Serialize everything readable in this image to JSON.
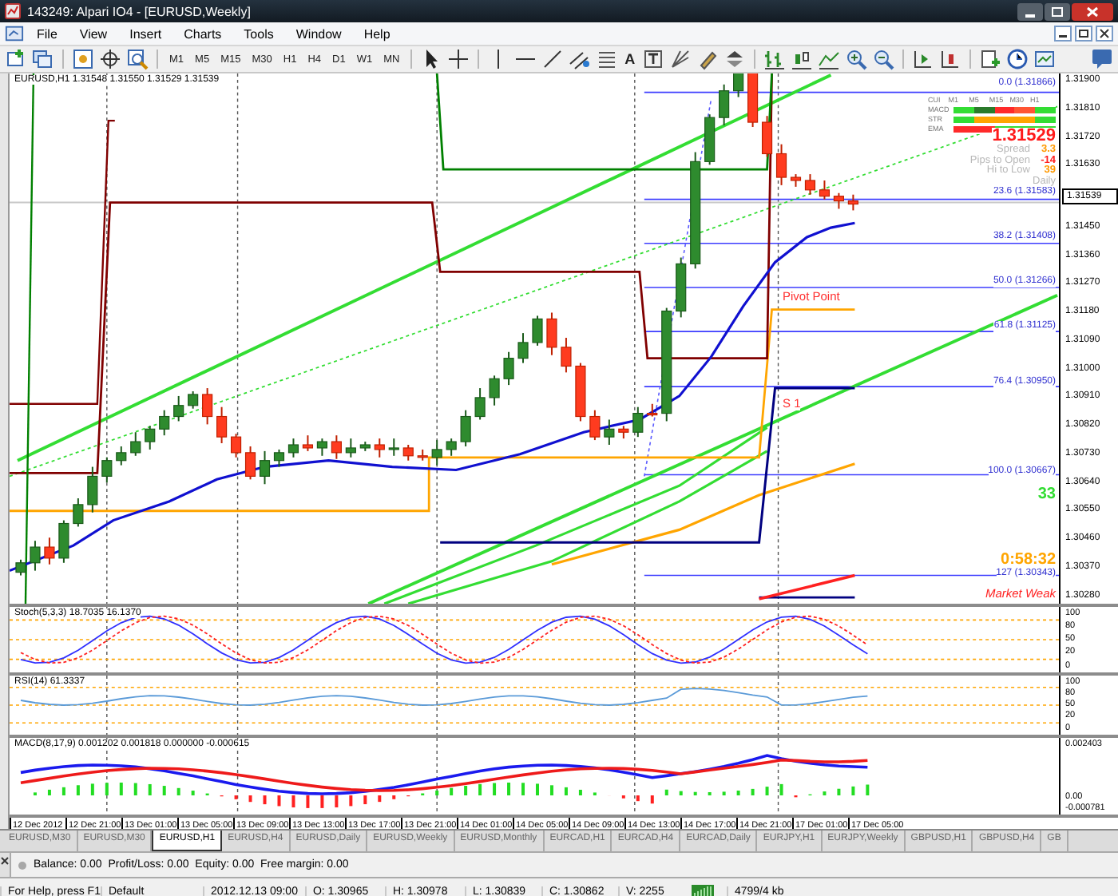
{
  "window": {
    "title": "143249: Alpari IO4 - [EURUSD,Weekly]"
  },
  "menu": [
    "File",
    "View",
    "Insert",
    "Charts",
    "Tools",
    "Window",
    "Help"
  ],
  "toolbar": {
    "timeframes": [
      "M1",
      "M5",
      "M15",
      "M30",
      "H1",
      "H4",
      "D1",
      "W1",
      "MN"
    ],
    "text_tool": "A"
  },
  "chart": {
    "header": "EURUSD,H1  1.31548 1.31550 1.31529 1.31539",
    "price_axis": [
      {
        "kind": "tick",
        "label": "1.31900"
      },
      {
        "kind": "tick",
        "label": "1.31810"
      },
      {
        "kind": "tick",
        "label": "1.31720"
      },
      {
        "kind": "tick",
        "label": "1.31630"
      },
      {
        "kind": "current",
        "label": "1.31539"
      },
      {
        "kind": "tick",
        "label": "1.31450"
      },
      {
        "kind": "tick",
        "label": "1.31360"
      },
      {
        "kind": "tick",
        "label": "1.31270"
      },
      {
        "kind": "tick",
        "label": "1.31180"
      },
      {
        "kind": "tick",
        "label": "1.31090"
      },
      {
        "kind": "tick",
        "label": "1.31000"
      },
      {
        "kind": "tick",
        "label": "1.30910"
      },
      {
        "kind": "tick",
        "label": "1.30820"
      },
      {
        "kind": "tick",
        "label": "1.30730"
      },
      {
        "kind": "tick",
        "label": "1.30640"
      },
      {
        "kind": "tick",
        "label": "1.30550"
      },
      {
        "kind": "tick",
        "label": "1.30460"
      },
      {
        "kind": "tick",
        "label": "1.30370"
      },
      {
        "kind": "tick",
        "label": "1.30280"
      }
    ],
    "fib_levels": [
      "0.0 (1.31866)",
      "23.6 (1.31583)",
      "38.2 (1.31408)",
      "50.0 (1.31266)",
      "61.8 (1.31125)",
      "76.4 (1.30950)",
      "100.0 (1.30667)",
      "127 (1.30343)"
    ],
    "pivot_labels": [
      "Pivot Point",
      "S 1"
    ],
    "dashboard": {
      "columns": [
        "CUI",
        "M1",
        "M5",
        "M15",
        "M30",
        "H1"
      ],
      "rows": [
        {
          "label": "MACD",
          "cells": [
            {
              "color": "#33dd33"
            },
            {
              "color": "#2a7a2a"
            },
            {
              "color": "#ff2a2a"
            },
            {
              "color": "#ff5533"
            },
            {
              "color": "#33dd33"
            }
          ]
        },
        {
          "label": "STR",
          "cells": [
            {
              "color": "#33dd33"
            },
            {
              "color": "#ffa500"
            },
            {
              "color": "#ffa500"
            },
            {
              "color": "#ffa500"
            },
            {
              "color": "#33dd33"
            }
          ]
        },
        {
          "label": "EMA",
          "cells": [
            {
              "color": "#ff2a2a"
            },
            {
              "color": "#ff2a2a"
            },
            {
              "color": "#33dd33"
            },
            {
              "color": "#33dd33"
            },
            {
              "color": "#33dd33"
            }
          ]
        }
      ]
    },
    "price": "1.31529",
    "stats": [
      {
        "label": "Spread",
        "value": "3.3",
        "color": "#ff9900"
      },
      {
        "label": "Pips to Open",
        "value": "-14",
        "color": "#ff2020"
      },
      {
        "label": "Hi to Low",
        "value": "39",
        "color": "#ff9900"
      },
      {
        "label": "Daily"
      }
    ],
    "counter": "33",
    "timer": "0:58:32",
    "signal": "Market Weak"
  },
  "indicators": [
    {
      "kind": "stoch",
      "header": "Stoch(5,3,3) 18.7035 16.1370",
      "axis": [
        "100",
        "80",
        "50",
        "20",
        "0"
      ]
    },
    {
      "kind": "rsi",
      "header": "RSI(14) 61.3337",
      "axis": [
        "100",
        "80",
        "50",
        "20",
        "0"
      ]
    },
    {
      "kind": "macd",
      "header": "MACD(8,17,9) 0.001202 0.001818 0.000000 -0.000615",
      "axis": [
        "0.002403",
        "0.00",
        "-0.000781"
      ]
    }
  ],
  "time_axis": [
    "12 Dec 2012",
    "12 Dec 21:00",
    "13 Dec 01:00",
    "13 Dec 05:00",
    "13 Dec 09:00",
    "13 Dec 13:00",
    "13 Dec 17:00",
    "13 Dec 21:00",
    "14 Dec 01:00",
    "14 Dec 05:00",
    "14 Dec 09:00",
    "14 Dec 13:00",
    "14 Dec 17:00",
    "14 Dec 21:00",
    "17 Dec 01:00",
    "17 Dec 05:00"
  ],
  "tabs": [
    {
      "label": "EURUSD,M30",
      "selected": false
    },
    {
      "label": "EURUSD,M30",
      "selected": false
    },
    {
      "label": "EURUSD,H1",
      "selected": true
    },
    {
      "label": "EURUSD,H4",
      "selected": false
    },
    {
      "label": "EURUSD,Daily",
      "selected": false
    },
    {
      "label": "EURUSD,Weekly",
      "selected": false
    },
    {
      "label": "EURUSD,Monthly",
      "selected": false
    },
    {
      "label": "EURCAD,H1",
      "selected": false
    },
    {
      "label": "EURCAD,H4",
      "selected": false
    },
    {
      "label": "EURCAD,Daily",
      "selected": false
    },
    {
      "label": "EURJPY,H1",
      "selected": false
    },
    {
      "label": "EURJPY,Weekly",
      "selected": false
    },
    {
      "label": "GBPUSD,H1",
      "selected": false
    },
    {
      "label": "GBPUSD,H4",
      "selected": false
    },
    {
      "label": "GB",
      "selected": false
    }
  ],
  "terminal": {
    "account": "Balance: 0.00  Profit/Loss: 0.00  Equity: 0.00  Free margin: 0.00"
  },
  "status_bar": {
    "help": "For Help, press F1",
    "profile": "Default",
    "datetime": "2012.12.13 09:00",
    "open": "O: 1.30965",
    "high": "H: 1.30978",
    "low": "L: 1.30839",
    "close": "C: 1.30862",
    "volume": "V: 2255",
    "traffic": "4799/4 kb"
  }
}
